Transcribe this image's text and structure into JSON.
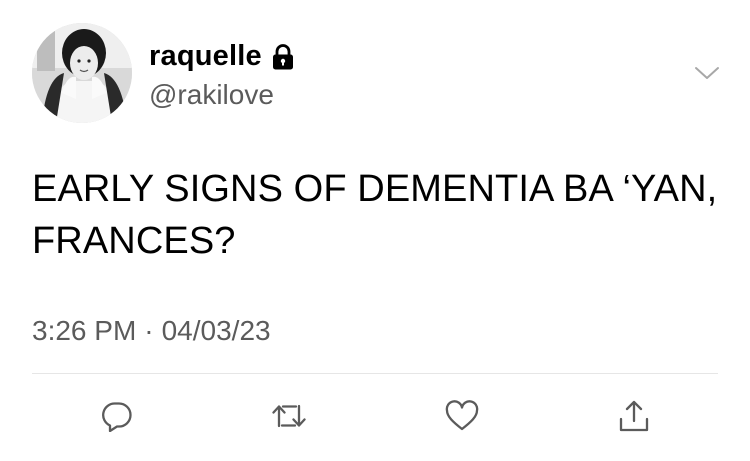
{
  "user": {
    "display_name": "raquelle",
    "handle": "@rakilove",
    "protected": true
  },
  "tweet": {
    "text": "EARLY SIGNS OF DEMENTIA BA ‘YAN,\nFRANCES?",
    "time": "3:26 PM",
    "separator": "·",
    "date": "04/03/23"
  },
  "icons": {
    "lock": "lock-icon",
    "more": "chevron-down-icon",
    "reply": "reply-icon",
    "retweet": "retweet-icon",
    "like": "heart-icon",
    "share": "share-icon"
  },
  "colors": {
    "text": "#000000",
    "secondary": "#5b5b5b",
    "icon": "#5b5b5b",
    "divider": "#e6e6e6"
  }
}
